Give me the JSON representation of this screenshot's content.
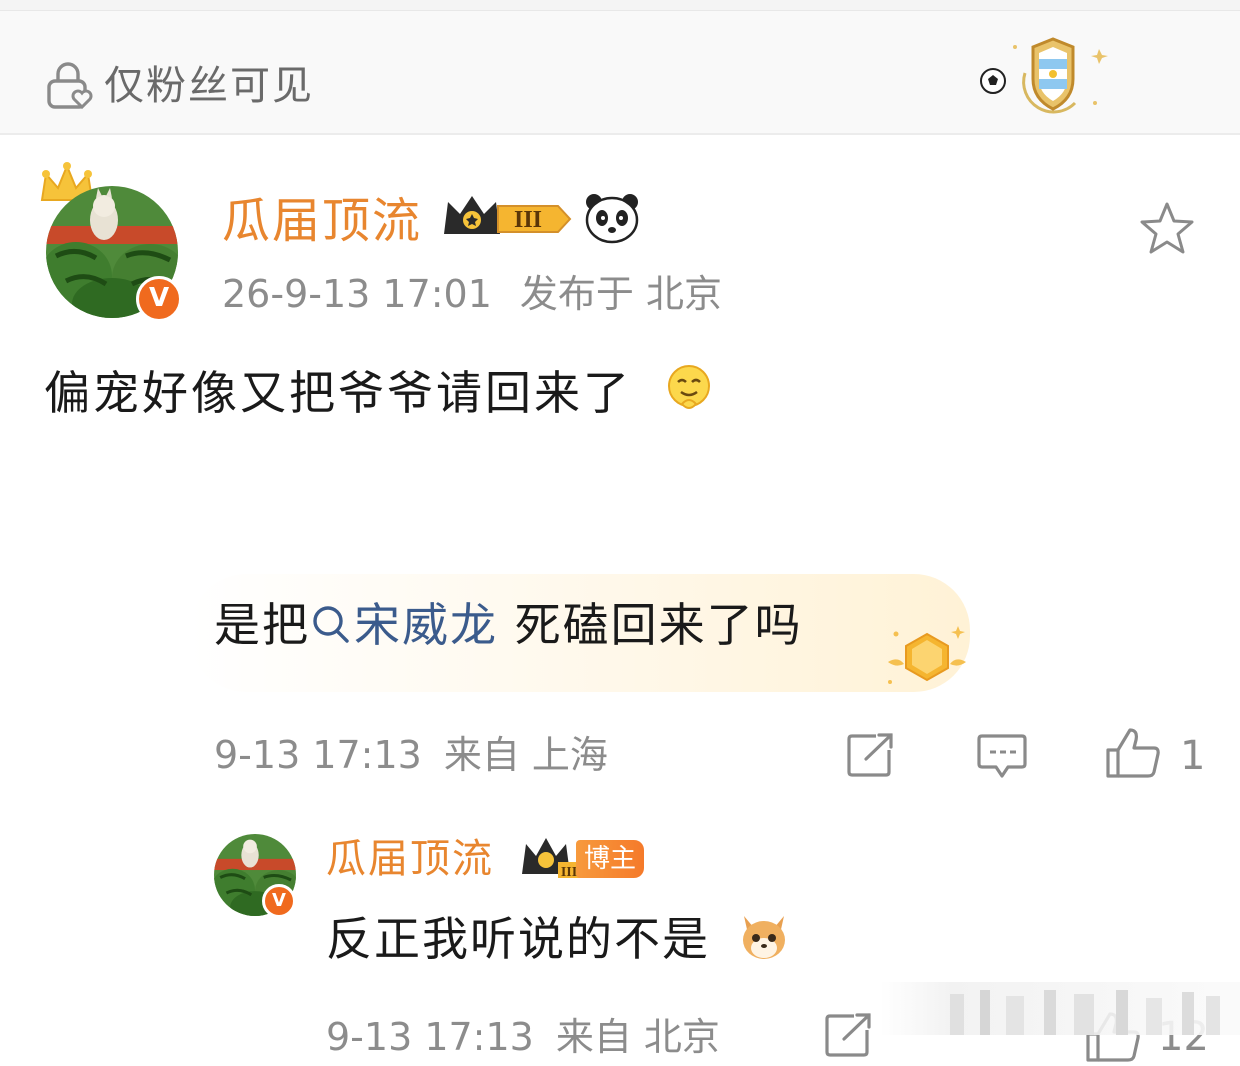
{
  "visibility": {
    "text": "仅粉丝可见"
  },
  "post": {
    "author": "瓜届顶流",
    "level_badge": "III",
    "verified_mark": "V",
    "time": "26-9-13 17:01",
    "location": "发布于 北京",
    "content": "偏宠好像又把爷爷请回来了"
  },
  "reply": {
    "prefix": "是把",
    "topic_link": "宋威龙",
    "suffix": " 死磕回来了吗",
    "time": "9-13 17:13",
    "location": "来自 上海",
    "like_count": "1"
  },
  "subreply": {
    "author": "瓜届顶流",
    "level_badge": "III",
    "verified_mark": "V",
    "role_badge": "博主",
    "content": "反正我听说的不是",
    "time": "9-13 17:13",
    "location": "来自 北京",
    "like_count": "12"
  },
  "colors": {
    "username": "#e8862f",
    "meta": "#8c8c8c",
    "link": "#3b5b8c",
    "badge": "#f06a1e"
  },
  "icons": [
    "lock-heart-icon",
    "shield-badge-icon",
    "crown-icon",
    "panda-icon",
    "star-icon",
    "smile-icon",
    "search-icon",
    "medal-icon",
    "share-icon",
    "comment-icon",
    "like-icon",
    "dog-icon"
  ]
}
